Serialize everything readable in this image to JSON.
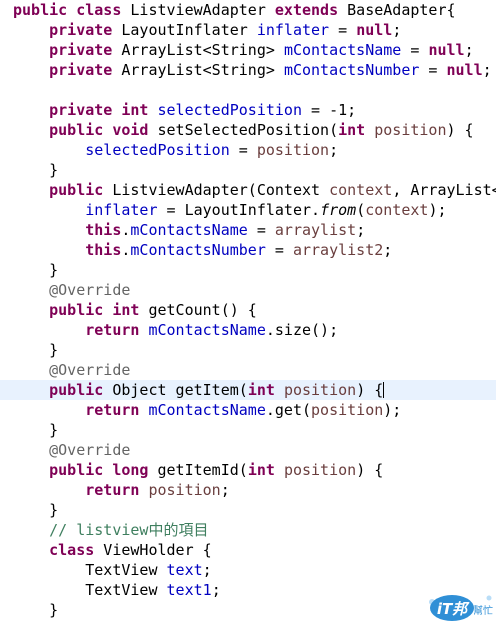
{
  "editor": {
    "indent": "    ",
    "highlighted_line": 19,
    "caret": {
      "line": 19,
      "token": 6,
      "offset": 5
    },
    "lines": [
      [
        [
          "kw",
          "public"
        ],
        [
          "t",
          " "
        ],
        [
          "kw",
          "class"
        ],
        [
          "t",
          " ListviewAdapter "
        ],
        [
          "kw",
          "extends"
        ],
        [
          "t",
          " BaseAdapter{"
        ]
      ],
      [
        [
          "i",
          1
        ],
        [
          "kw",
          "private"
        ],
        [
          "t",
          " LayoutInflater "
        ],
        [
          "fld",
          "inflater"
        ],
        [
          "t",
          " = "
        ],
        [
          "kw",
          "null"
        ],
        [
          "t",
          ";"
        ]
      ],
      [
        [
          "i",
          1
        ],
        [
          "kw",
          "private"
        ],
        [
          "t",
          " ArrayList<String> "
        ],
        [
          "fld",
          "mContactsName"
        ],
        [
          "t",
          " = "
        ],
        [
          "kw",
          "null"
        ],
        [
          "t",
          ";"
        ]
      ],
      [
        [
          "i",
          1
        ],
        [
          "kw",
          "private"
        ],
        [
          "t",
          " ArrayList<String> "
        ],
        [
          "fld",
          "mContactsNumber"
        ],
        [
          "t",
          " = "
        ],
        [
          "kw",
          "null"
        ],
        [
          "t",
          ";"
        ]
      ],
      [],
      [
        [
          "i",
          1
        ],
        [
          "kw",
          "private"
        ],
        [
          "t",
          " "
        ],
        [
          "kw",
          "int"
        ],
        [
          "t",
          " "
        ],
        [
          "fld",
          "selectedPosition"
        ],
        [
          "t",
          " = -1;"
        ]
      ],
      [
        [
          "i",
          1
        ],
        [
          "kw",
          "public"
        ],
        [
          "t",
          " "
        ],
        [
          "kw",
          "void"
        ],
        [
          "t",
          " setSelectedPosition("
        ],
        [
          "kw",
          "int"
        ],
        [
          "t",
          " "
        ],
        [
          "var",
          "position"
        ],
        [
          "t",
          ") {"
        ]
      ],
      [
        [
          "i",
          2
        ],
        [
          "fld",
          "selectedPosition"
        ],
        [
          "t",
          " = "
        ],
        [
          "var",
          "position"
        ],
        [
          "t",
          ";"
        ]
      ],
      [
        [
          "i",
          1
        ],
        [
          "t",
          "}"
        ]
      ],
      [
        [
          "i",
          1
        ],
        [
          "kw",
          "public"
        ],
        [
          "t",
          " ListviewAdapter(Context "
        ],
        [
          "var",
          "context"
        ],
        [
          "t",
          ", ArrayList<"
        ]
      ],
      [
        [
          "i",
          2
        ],
        [
          "fld",
          "inflater"
        ],
        [
          "t",
          " = LayoutInflater."
        ],
        [
          "it",
          "from"
        ],
        [
          "t",
          "("
        ],
        [
          "var",
          "context"
        ],
        [
          "t",
          ");"
        ]
      ],
      [
        [
          "i",
          2
        ],
        [
          "kw",
          "this"
        ],
        [
          "t",
          "."
        ],
        [
          "fld",
          "mContactsName"
        ],
        [
          "t",
          " = "
        ],
        [
          "var",
          "arraylist"
        ],
        [
          "t",
          ";"
        ]
      ],
      [
        [
          "i",
          2
        ],
        [
          "kw",
          "this"
        ],
        [
          "t",
          "."
        ],
        [
          "fld",
          "mContactsNumber"
        ],
        [
          "t",
          " = "
        ],
        [
          "var",
          "arraylist2"
        ],
        [
          "t",
          ";"
        ]
      ],
      [
        [
          "i",
          1
        ],
        [
          "t",
          "}"
        ]
      ],
      [
        [
          "i",
          1
        ],
        [
          "ann",
          "@Override"
        ]
      ],
      [
        [
          "i",
          1
        ],
        [
          "kw",
          "public"
        ],
        [
          "t",
          " "
        ],
        [
          "kw",
          "int"
        ],
        [
          "t",
          " getCount() {"
        ]
      ],
      [
        [
          "i",
          2
        ],
        [
          "kw",
          "return"
        ],
        [
          "t",
          " "
        ],
        [
          "fld",
          "mContactsName"
        ],
        [
          "t",
          ".size();"
        ]
      ],
      [
        [
          "i",
          1
        ],
        [
          "t",
          "}"
        ]
      ],
      [
        [
          "i",
          1
        ],
        [
          "ann",
          "@Override"
        ]
      ],
      [
        [
          "i",
          1
        ],
        [
          "kw",
          "public"
        ],
        [
          "t",
          " Object getItem("
        ],
        [
          "kw",
          "int"
        ],
        [
          "t",
          " "
        ],
        [
          "var",
          "position"
        ],
        [
          "t",
          ") {"
        ]
      ],
      [
        [
          "i",
          2
        ],
        [
          "kw",
          "return"
        ],
        [
          "t",
          " "
        ],
        [
          "fld",
          "mContactsName"
        ],
        [
          "t",
          ".get("
        ],
        [
          "var",
          "position"
        ],
        [
          "t",
          ");"
        ]
      ],
      [
        [
          "i",
          1
        ],
        [
          "t",
          "}"
        ]
      ],
      [
        [
          "i",
          1
        ],
        [
          "ann",
          "@Override"
        ]
      ],
      [
        [
          "i",
          1
        ],
        [
          "kw",
          "public"
        ],
        [
          "t",
          " "
        ],
        [
          "kw",
          "long"
        ],
        [
          "t",
          " getItemId("
        ],
        [
          "kw",
          "int"
        ],
        [
          "t",
          " "
        ],
        [
          "var",
          "position"
        ],
        [
          "t",
          ") {"
        ]
      ],
      [
        [
          "i",
          2
        ],
        [
          "kw",
          "return"
        ],
        [
          "t",
          " "
        ],
        [
          "var",
          "position"
        ],
        [
          "t",
          ";"
        ]
      ],
      [
        [
          "i",
          1
        ],
        [
          "t",
          "}"
        ]
      ],
      [
        [
          "i",
          1
        ],
        [
          "cmt",
          "// listview中的項目"
        ]
      ],
      [
        [
          "i",
          1
        ],
        [
          "kw",
          "class"
        ],
        [
          "t",
          " ViewHolder {"
        ]
      ],
      [
        [
          "i",
          2
        ],
        [
          "t",
          "TextView "
        ],
        [
          "fld",
          "text"
        ],
        [
          "t",
          ";"
        ]
      ],
      [
        [
          "i",
          2
        ],
        [
          "t",
          "TextView "
        ],
        [
          "fld",
          "text1"
        ],
        [
          "t",
          ";"
        ]
      ],
      [
        [
          "i",
          1
        ],
        [
          "t",
          "}"
        ]
      ]
    ]
  },
  "watermark": {
    "text": "iT邦",
    "subtext": "幫忙",
    "colors": {
      "primary": "#2f8fd6",
      "light": "#a8d4f5"
    }
  },
  "colors": {
    "keyword": "#7f0055",
    "field": "#0000c0",
    "variable": "#6a3e3e",
    "annotation": "#646464",
    "comment": "#3f7f5f",
    "highlight": "#e8f2fe"
  }
}
